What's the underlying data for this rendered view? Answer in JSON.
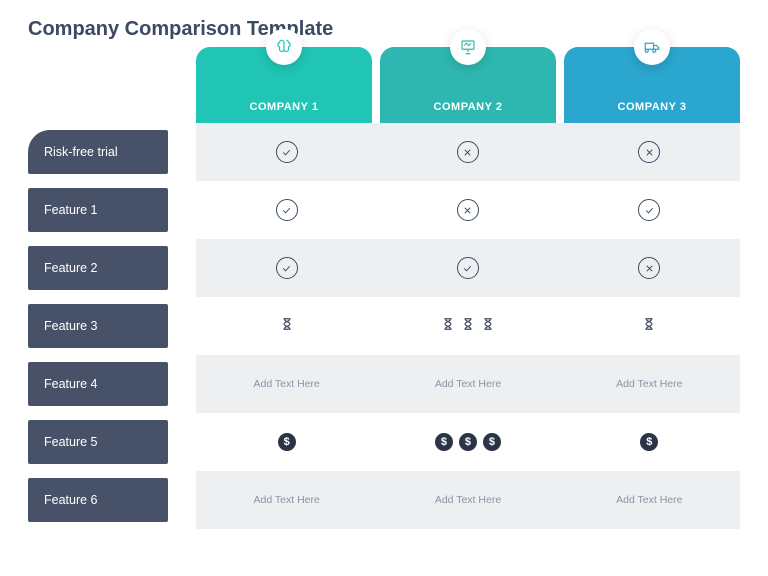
{
  "title": "Company Comparison Template",
  "columns": {
    "c1": {
      "label": "COMPANY 1"
    },
    "c2": {
      "label": "COMPANY 2"
    },
    "c3": {
      "label": "COMPANY 3"
    }
  },
  "rows": {
    "r0": {
      "label": "Risk-free trial",
      "c1": {
        "type": "check"
      },
      "c2": {
        "type": "cross"
      },
      "c3": {
        "type": "cross"
      }
    },
    "r1": {
      "label": "Feature 1",
      "c1": {
        "type": "check"
      },
      "c2": {
        "type": "cross"
      },
      "c3": {
        "type": "check"
      }
    },
    "r2": {
      "label": "Feature 2",
      "c1": {
        "type": "check"
      },
      "c2": {
        "type": "check"
      },
      "c3": {
        "type": "cross"
      }
    },
    "r3": {
      "label": "Feature 3",
      "c1": {
        "type": "hour",
        "count": 1
      },
      "c2": {
        "type": "hour",
        "count": 3
      },
      "c3": {
        "type": "hour",
        "count": 1
      }
    },
    "r4": {
      "label": "Feature 4",
      "c1": {
        "type": "text",
        "text": "Add Text Here"
      },
      "c2": {
        "type": "text",
        "text": "Add Text Here"
      },
      "c3": {
        "type": "text",
        "text": "Add Text Here"
      }
    },
    "r5": {
      "label": "Feature 5",
      "c1": {
        "type": "dollar",
        "count": 1
      },
      "c2": {
        "type": "dollar",
        "count": 3
      },
      "c3": {
        "type": "dollar",
        "count": 1
      }
    },
    "r6": {
      "label": "Feature 6",
      "c1": {
        "type": "text",
        "text": "Add Text Here"
      },
      "c2": {
        "type": "text",
        "text": "Add Text Here"
      },
      "c3": {
        "type": "text",
        "text": "Add Text Here"
      }
    }
  },
  "dollar_glyph": "$"
}
